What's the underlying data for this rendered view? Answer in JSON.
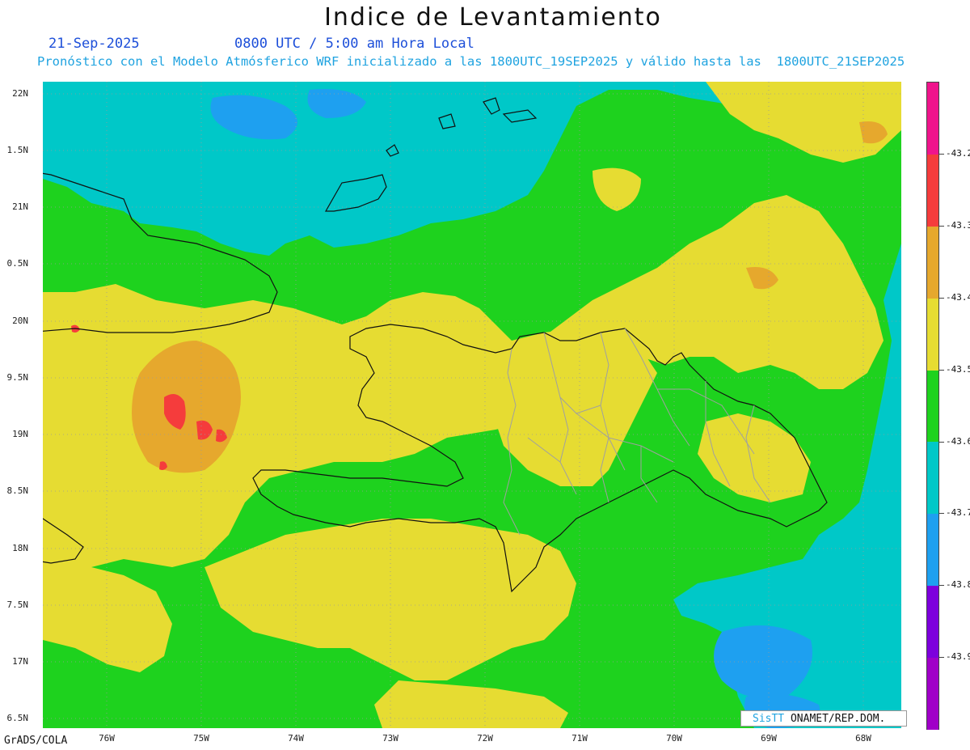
{
  "title": "Indice de Levantamiento",
  "date": "21-Sep-2025",
  "time_text": "0800 UTC / 5:00 am Hora Local",
  "forecast_text": "Pronóstico con el Modelo Atmósferico WRF inicializado a las 1800UTC_19SEP2025 y válido hasta las  1800UTC_21SEP2025",
  "latitude_labels": [
    "22N",
    "1.5N",
    "21N",
    "0.5N",
    "20N",
    "9.5N",
    "19N",
    "8.5N",
    "18N",
    "7.5N",
    "17N",
    "6.5N"
  ],
  "longitude_labels": [
    "76W",
    "75W",
    "74W",
    "73W",
    "72W",
    "71W",
    "70W",
    "69W",
    "68W"
  ],
  "software_label": "GrADS/COLA",
  "credit": {
    "brand": "SisTT",
    "org": " ONAMET/REP.DOM."
  },
  "colorbar": {
    "labels": [
      "-43.2",
      "-43.3",
      "-43.4",
      "-43.5",
      "-43.6",
      "-43.7",
      "-43.8",
      "-43.9"
    ],
    "colors": [
      "#f0148c",
      "#f53c3c",
      "#e6a82d",
      "#e6dc32",
      "#1ed21e",
      "#00c8c8",
      "#1ea0f0",
      "#7d00dc",
      "#a000c8"
    ]
  },
  "map_colors": {
    "cyan": "#00c8c8",
    "green": "#1ed21e",
    "yellow": "#e6dc32",
    "orange": "#e6a82d",
    "red": "#f53c3c",
    "blue": "#1ea0f0"
  }
}
